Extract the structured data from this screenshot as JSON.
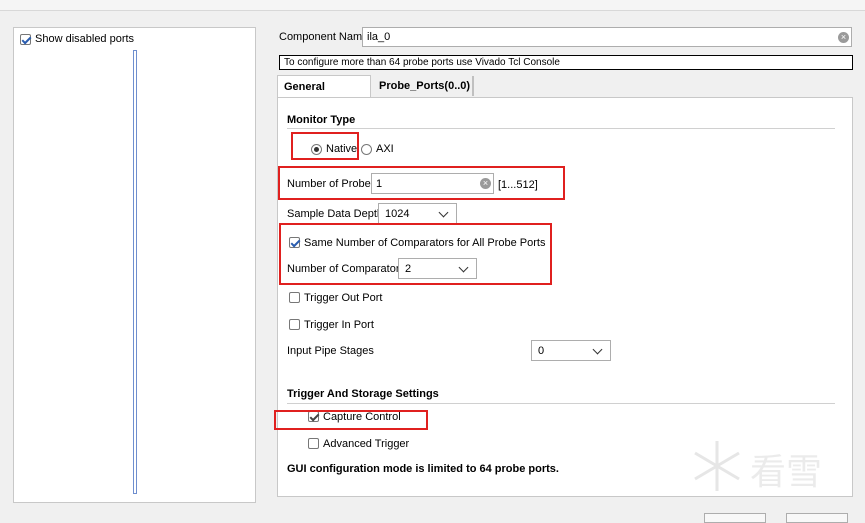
{
  "left": {
    "show_disabled_label": "Show disabled ports",
    "show_disabled_checked": true
  },
  "component": {
    "label": "Component Name",
    "value": "ila_0"
  },
  "info_text": "To configure more than 64 probe ports use Vivado Tcl Console",
  "tabs": [
    {
      "label": "General Options",
      "active": true
    },
    {
      "label": "Probe_Ports(0..0)",
      "active": false
    }
  ],
  "monitor_type": {
    "title": "Monitor Type",
    "native_label": "Native",
    "axi_label": "AXI",
    "selected": "Native"
  },
  "probes": {
    "label": "Number of Probes",
    "value": "1",
    "range": "[1...512]"
  },
  "sample_depth": {
    "label": "Sample Data Depth",
    "value": "1024"
  },
  "comparators": {
    "same_label": "Same Number of Comparators for All Probe Ports",
    "same_checked": true,
    "count_label": "Number of Comparators",
    "count_value": "2"
  },
  "trigger_out": {
    "label": "Trigger Out Port",
    "checked": false
  },
  "trigger_in": {
    "label": "Trigger In Port",
    "checked": false
  },
  "pipe_stages": {
    "label": "Input Pipe Stages",
    "value": "0"
  },
  "storage": {
    "title": "Trigger And Storage Settings",
    "capture_label": "Capture Control",
    "capture_checked": true,
    "advanced_label": "Advanced Trigger",
    "advanced_checked": false
  },
  "footer_note": "GUI configuration mode is limited to 64 probe ports.",
  "watermark": "看雪",
  "colors": {
    "highlight": "#e0201f",
    "accent": "#2a5db0"
  }
}
